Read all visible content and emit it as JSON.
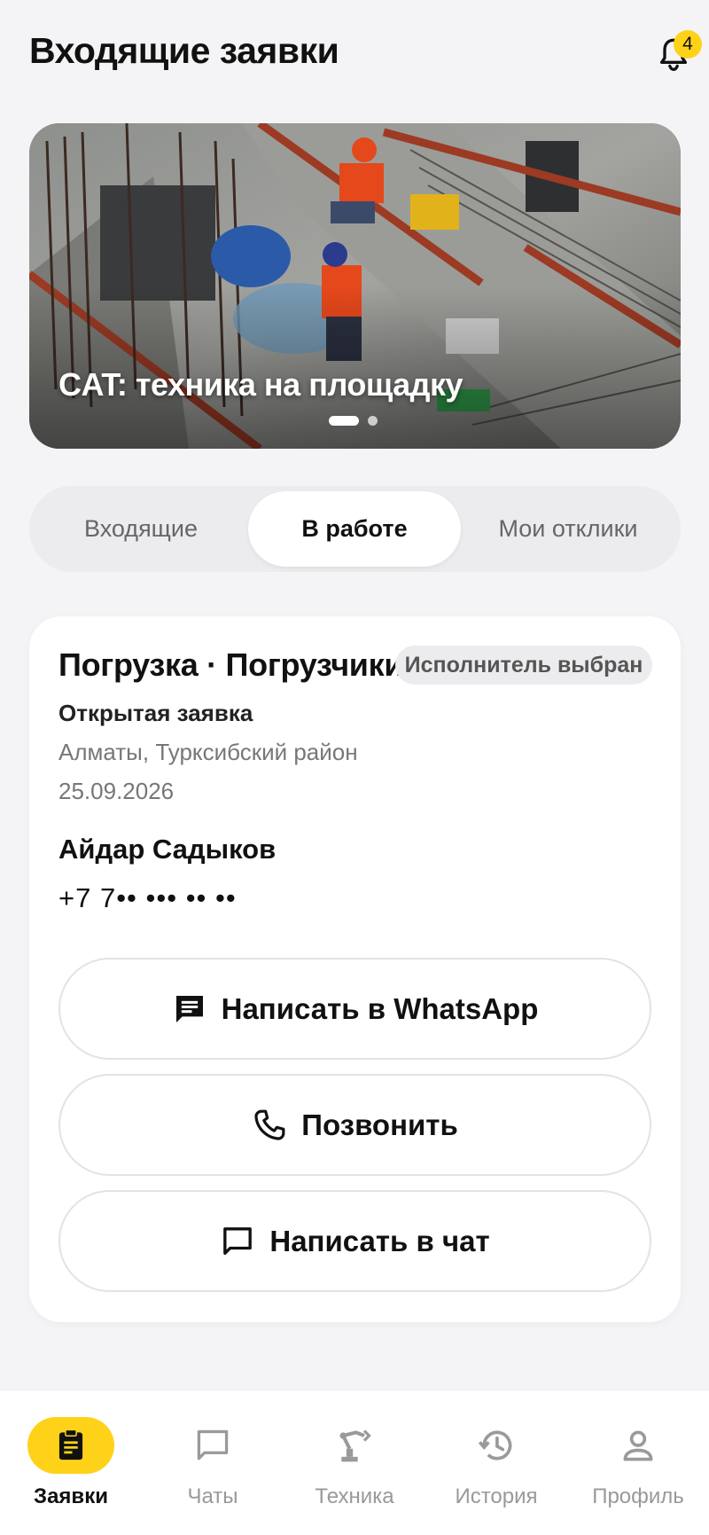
{
  "header": {
    "title": "Входящие заявки",
    "notifications_count": "4"
  },
  "banner": {
    "title": "CAT: техника на площадку",
    "slide_index": 1,
    "slide_count": 2
  },
  "tabs": [
    {
      "label": "Входящие",
      "active": false
    },
    {
      "label": "В работе",
      "active": true
    },
    {
      "label": "Мои отклики",
      "active": false
    }
  ],
  "card": {
    "title": "Погрузка · Погрузчики",
    "status": "Исполнитель выбран",
    "request_type": "Открытая заявка",
    "location": "Алматы, Турксибский район",
    "date": "25.09.2026",
    "contact_name": "Айдар Садыков",
    "contact_phone": "+7 7•• ••• •• ••",
    "buttons": {
      "whatsapp": "Написать в WhatsApp",
      "call": "Позвонить",
      "chat": "Написать в чат"
    }
  },
  "bottom_nav": [
    {
      "label": "Заявки",
      "icon": "clipboard-icon",
      "active": true
    },
    {
      "label": "Чаты",
      "icon": "chat-bubble-icon",
      "active": false
    },
    {
      "label": "Техника",
      "icon": "excavator-arm-icon",
      "active": false
    },
    {
      "label": "История",
      "icon": "history-icon",
      "active": false
    },
    {
      "label": "Профиль",
      "icon": "person-icon",
      "active": false
    }
  ],
  "colors": {
    "accent": "#ffd21a",
    "background": "#f4f4f7",
    "card": "#ffffff",
    "segment_track": "#ececef"
  }
}
